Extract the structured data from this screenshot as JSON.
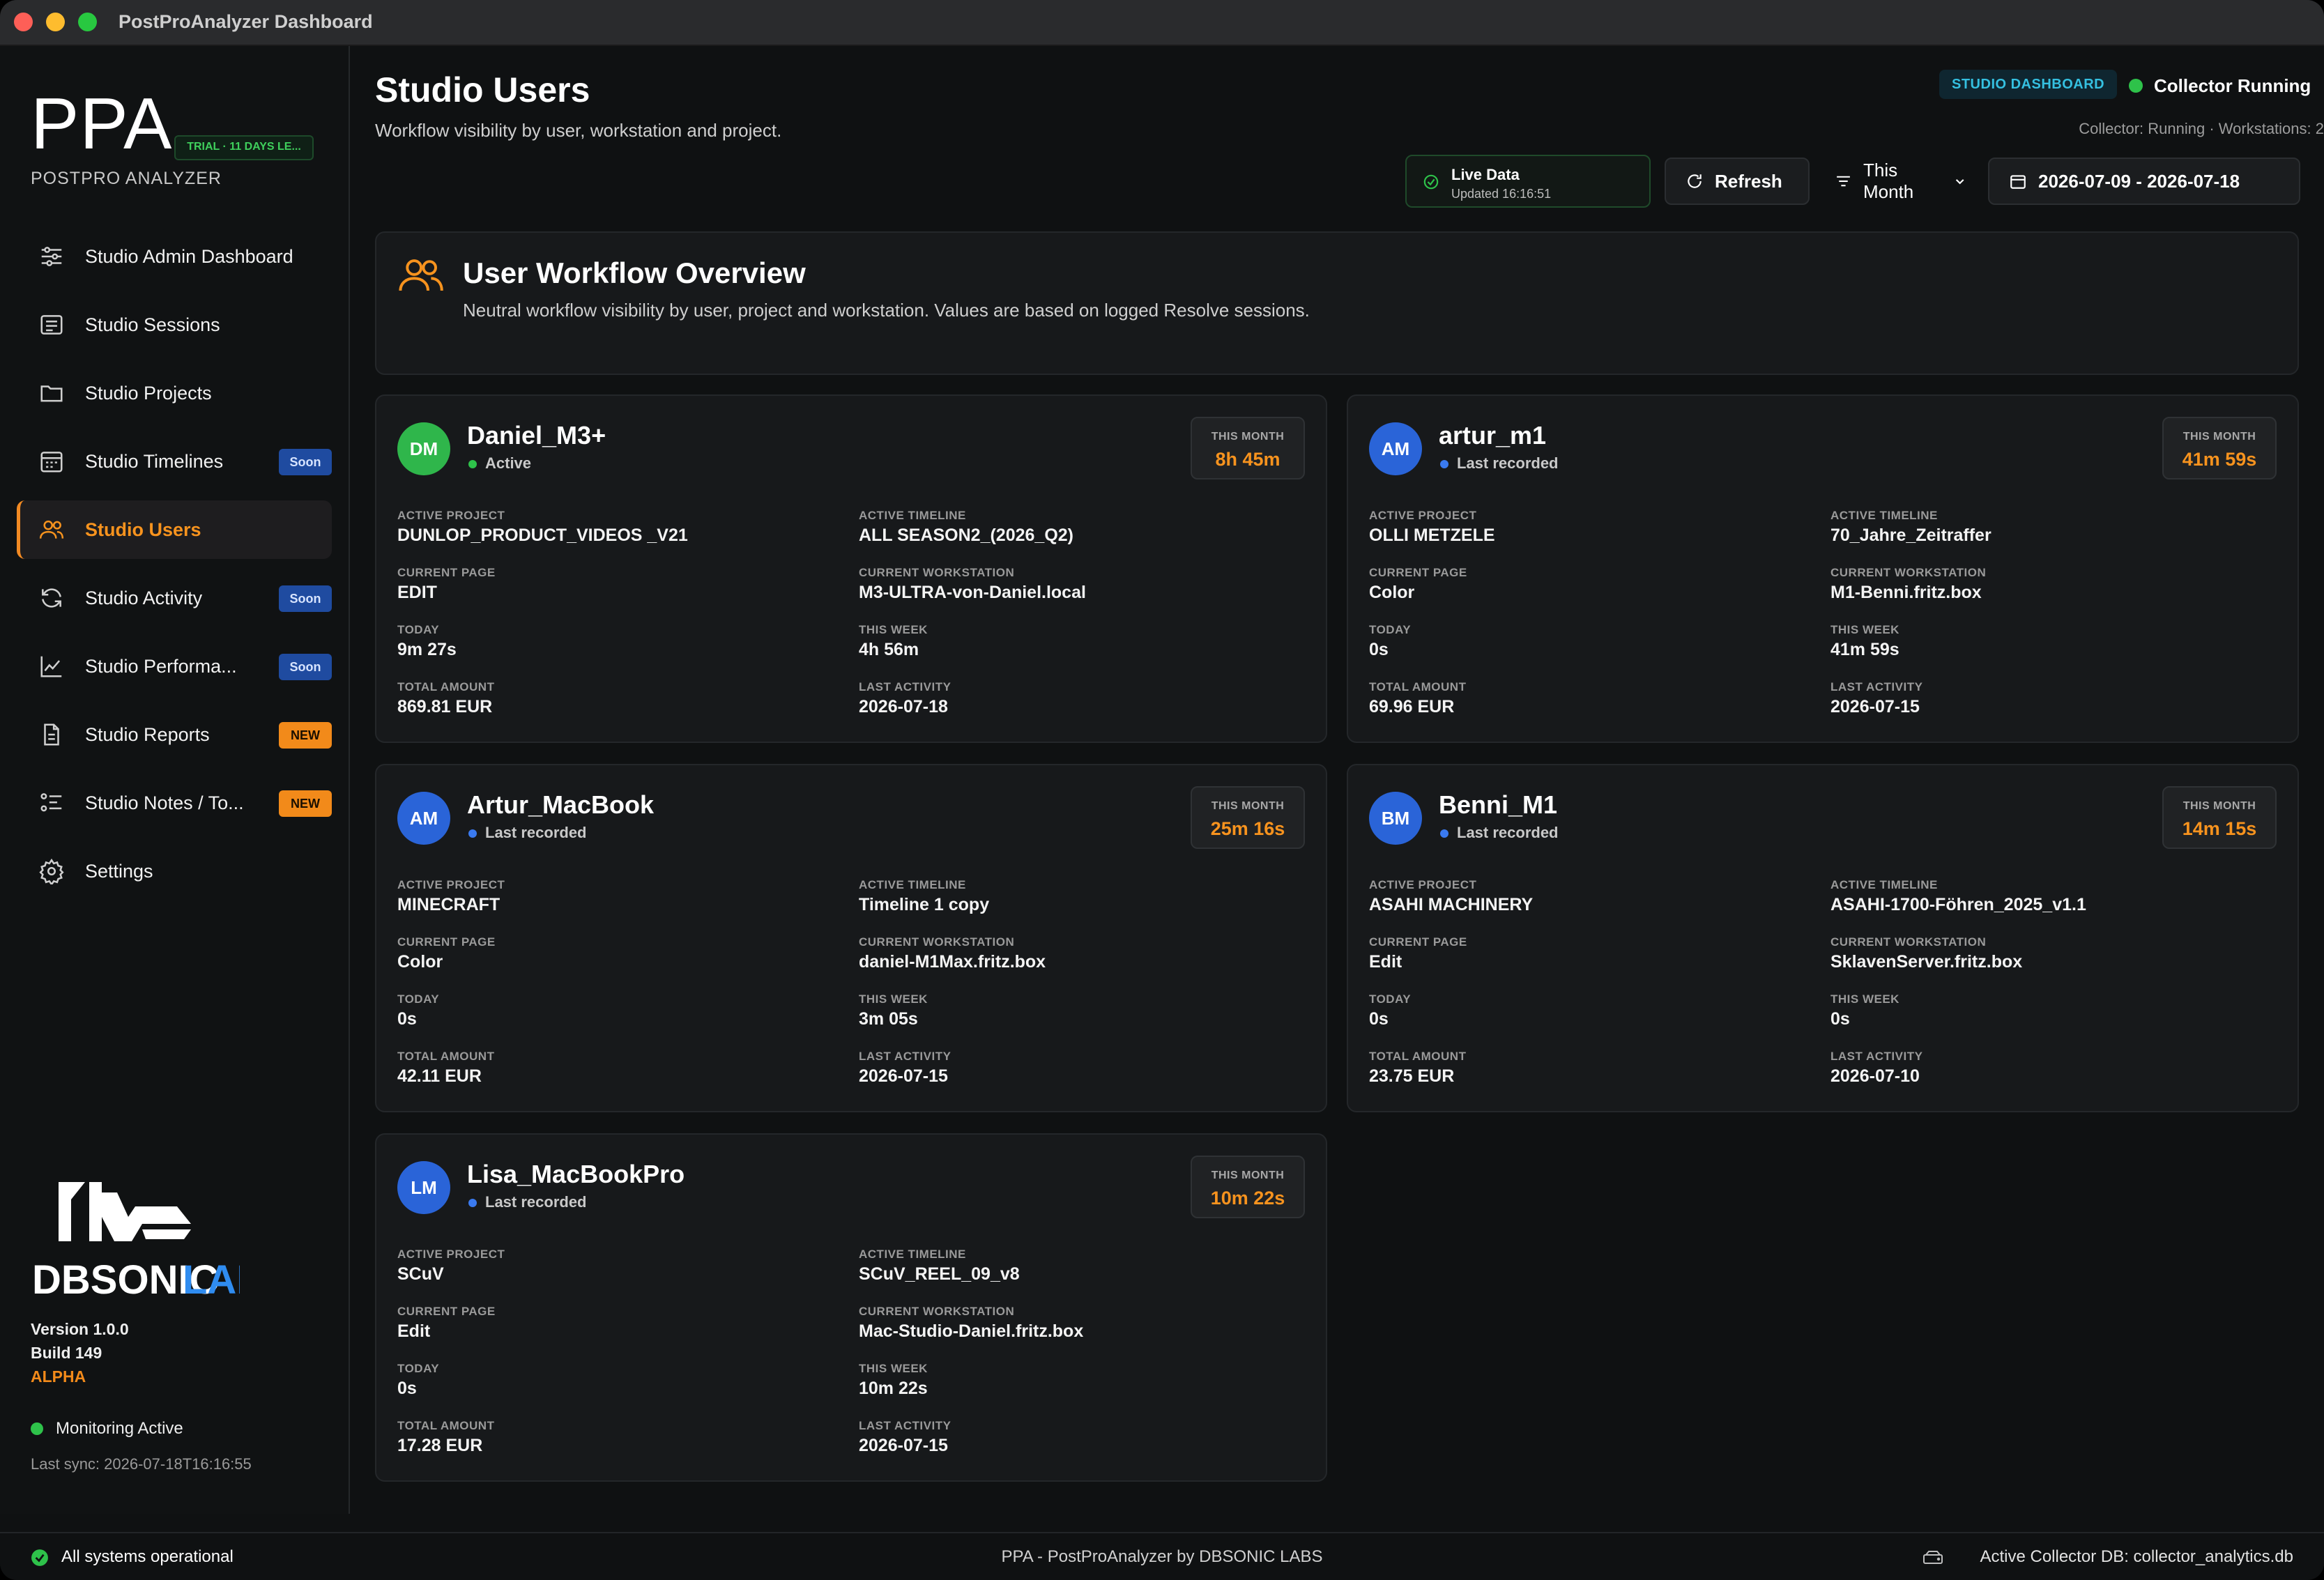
{
  "window": {
    "title": "PostProAnalyzer Dashboard"
  },
  "sidebar": {
    "logo": "PPA",
    "trial_badge": "TRIAL · 11 DAYS LE...",
    "subtitle": "POSTPRO ANALYZER",
    "items": [
      {
        "label": "Studio Admin Dashboard",
        "icon": "sliders-icon",
        "badge": ""
      },
      {
        "label": "Studio Sessions",
        "icon": "list-icon",
        "badge": ""
      },
      {
        "label": "Studio Projects",
        "icon": "folder-icon",
        "badge": ""
      },
      {
        "label": "Studio Timelines",
        "icon": "calendar-icon",
        "badge": "Soon"
      },
      {
        "label": "Studio Users",
        "icon": "users-icon",
        "badge": "",
        "active": true
      },
      {
        "label": "Studio Activity",
        "icon": "refresh-icon",
        "badge": "Soon"
      },
      {
        "label": "Studio Performa...",
        "icon": "chart-icon",
        "badge": "Soon"
      },
      {
        "label": "Studio Reports",
        "icon": "document-icon",
        "badge": "NEW"
      },
      {
        "label": "Studio Notes / To...",
        "icon": "checklist-icon",
        "badge": "NEW"
      },
      {
        "label": "Settings",
        "icon": "gear-icon",
        "badge": ""
      }
    ],
    "brand": "DBSONIC LABS",
    "brand_word1": "DBSONIC",
    "brand_word2": "LABS",
    "version": "Version 1.0.0",
    "build": "Build 149",
    "channel": "ALPHA",
    "monitoring": "Monitoring Active",
    "last_sync": "Last sync: 2026-07-18T16:16:55"
  },
  "header": {
    "title": "Studio Users",
    "subtitle": "Workflow visibility by user, workstation and project.",
    "studio_badge": "STUDIO DASHBOARD",
    "collector_status": "Collector Running",
    "collector_meta": "Collector: Running · Workstations: 2",
    "live_title": "Live Data",
    "live_updated": "Updated 16:16:51",
    "refresh_label": "Refresh",
    "period_label": "This Month",
    "date_range": "2026-07-09 - 2026-07-18"
  },
  "overview": {
    "title": "User Workflow Overview",
    "subtitle": "Neutral workflow visibility by user, project and workstation. Values are based on logged Resolve sessions."
  },
  "field_labels": {
    "active_project": "ACTIVE PROJECT",
    "active_timeline": "ACTIVE TIMELINE",
    "current_page": "CURRENT PAGE",
    "current_workstation": "CURRENT WORKSTATION",
    "today": "TODAY",
    "this_week": "THIS WEEK",
    "total_amount": "TOTAL AMOUNT",
    "last_activity": "LAST ACTIVITY",
    "this_month": "THIS MONTH"
  },
  "users": [
    {
      "initials": "DM",
      "name": "Daniel_M3+",
      "status": "Active",
      "avatar_color": "green",
      "this_month": "8h 45m",
      "active_project": "DUNLOP_PRODUCT_VIDEOS _V21",
      "active_timeline": "ALL SEASON2_(2026_Q2)",
      "current_page": "EDIT",
      "current_workstation": "M3-ULTRA-von-Daniel.local",
      "today": "9m 27s",
      "this_week": "4h 56m",
      "total_amount": "869.81 EUR",
      "last_activity": "2026-07-18"
    },
    {
      "initials": "AM",
      "name": "artur_m1",
      "status": "Last recorded",
      "avatar_color": "blue",
      "this_month": "41m 59s",
      "active_project": "OLLI METZELE",
      "active_timeline": "70_Jahre_Zeitraffer",
      "current_page": "Color",
      "current_workstation": "M1-Benni.fritz.box",
      "today": "0s",
      "this_week": "41m 59s",
      "total_amount": "69.96 EUR",
      "last_activity": "2026-07-15"
    },
    {
      "initials": "AM",
      "name": "Artur_MacBook",
      "status": "Last recorded",
      "avatar_color": "blue",
      "this_month": "25m 16s",
      "active_project": "MINECRAFT",
      "active_timeline": "Timeline 1 copy",
      "current_page": "Color",
      "current_workstation": "daniel-M1Max.fritz.box",
      "today": "0s",
      "this_week": "3m 05s",
      "total_amount": "42.11 EUR",
      "last_activity": "2026-07-15"
    },
    {
      "initials": "BM",
      "name": "Benni_M1",
      "status": "Last recorded",
      "avatar_color": "blue",
      "this_month": "14m 15s",
      "active_project": "ASAHI MACHINERY",
      "active_timeline": "ASAHI-1700-Föhren_2025_v1.1",
      "current_page": "Edit",
      "current_workstation": "SklavenServer.fritz.box",
      "today": "0s",
      "this_week": "0s",
      "total_amount": "23.75 EUR",
      "last_activity": "2026-07-10"
    },
    {
      "initials": "LM",
      "name": "Lisa_MacBookPro",
      "status": "Last recorded",
      "avatar_color": "blue",
      "this_month": "10m 22s",
      "active_project": "SCuV",
      "active_timeline": "SCuV_REEL_09_v8",
      "current_page": "Edit",
      "current_workstation": "Mac-Studio-Daniel.fritz.box",
      "today": "0s",
      "this_week": "10m 22s",
      "total_amount": "17.28 EUR",
      "last_activity": "2026-07-15"
    }
  ],
  "statusbar": {
    "left": "All systems operational",
    "center": "PPA - PostProAnalyzer by DBSONIC LABS",
    "right": "Active Collector DB: collector_analytics.db"
  },
  "colors": {
    "accent": "#f7931e",
    "success": "#2ec24a",
    "info": "#2a64d8",
    "background": "#0f1112",
    "card": "#17191b"
  }
}
